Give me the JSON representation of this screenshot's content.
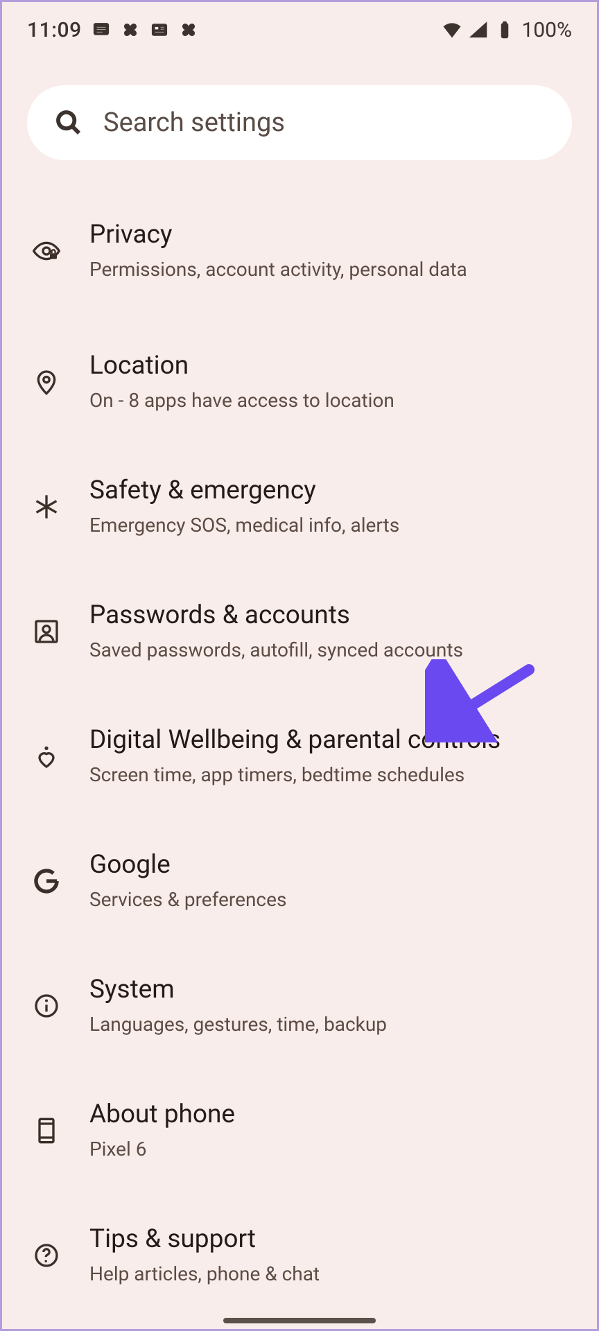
{
  "status": {
    "time": "11:09",
    "battery": "100%"
  },
  "search": {
    "placeholder": "Search settings"
  },
  "settings": [
    {
      "title": "Privacy",
      "subtitle": "Permissions, account activity, personal data"
    },
    {
      "title": "Location",
      "subtitle": "On - 8 apps have access to location"
    },
    {
      "title": "Safety & emergency",
      "subtitle": "Emergency SOS, medical info, alerts"
    },
    {
      "title": "Passwords & accounts",
      "subtitle": "Saved passwords, autofill, synced accounts"
    },
    {
      "title": "Digital Wellbeing & parental controls",
      "subtitle": "Screen time, app timers, bedtime schedules"
    },
    {
      "title": "Google",
      "subtitle": "Services & preferences"
    },
    {
      "title": "System",
      "subtitle": "Languages, gestures, time, backup"
    },
    {
      "title": "About phone",
      "subtitle": "Pixel 6"
    },
    {
      "title": "Tips & support",
      "subtitle": "Help articles, phone & chat"
    }
  ]
}
